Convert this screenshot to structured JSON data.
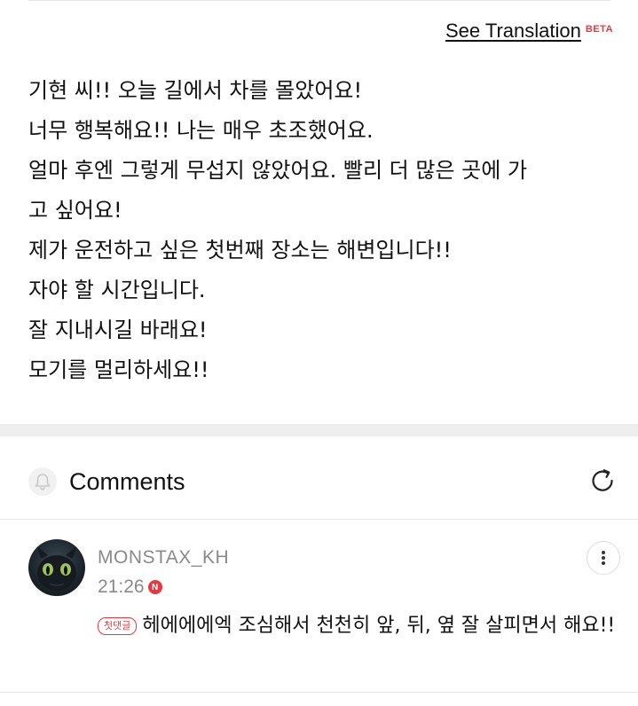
{
  "translation": {
    "link_label": "See Translation",
    "beta_label": "BETA",
    "beta_color": "#e8383d"
  },
  "post": {
    "lines": [
      "기현 씨!! 오늘 길에서 차를 몰았어요!",
      "너무 행복해요!! 나는 매우 초조했어요.",
      "얼마 후엔 그렇게 무섭지 않았어요. 빨리 더 많은 곳에 가",
      "고 싶어요!",
      "제가 운전하고 싶은 첫번째 장소는 해변입니다!!",
      "자야 할 시간입니다.",
      "잘 지내시길 바래요!",
      "모기를 멀리하세요!!"
    ]
  },
  "comments": {
    "title": "Comments",
    "bell_icon": "bell-icon",
    "refresh_icon": "refresh-icon",
    "items": [
      {
        "author": "MONSTAX_KH",
        "time": "21:26",
        "new_badge": "N",
        "new_badge_color": "#e8383d",
        "first_comment_badge": "첫댓글",
        "first_comment_badge_color": "#e8383d",
        "text": "헤에에에엑 조심해서 천천히 앞, 뒤, 옆 잘 살피면서 해요!!",
        "more_icon": "more-vertical-icon"
      }
    ]
  }
}
